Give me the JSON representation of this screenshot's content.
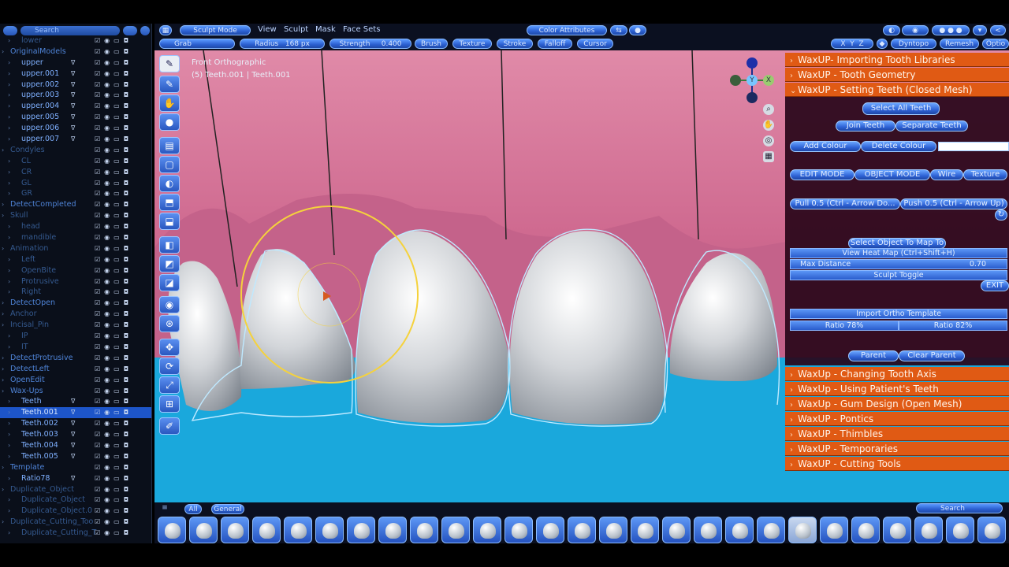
{
  "outliner": {
    "search_placeholder": "Search",
    "rows": [
      {
        "name": "lower",
        "kind": "dim",
        "indent": 1
      },
      {
        "name": "OriginalModels",
        "kind": "coll",
        "indent": 0
      },
      {
        "name": "upper",
        "kind": "obj",
        "indent": 1
      },
      {
        "name": "upper.001",
        "kind": "obj",
        "indent": 1
      },
      {
        "name": "upper.002",
        "kind": "obj",
        "indent": 1
      },
      {
        "name": "upper.003",
        "kind": "obj",
        "indent": 1
      },
      {
        "name": "upper.004",
        "kind": "obj",
        "indent": 1
      },
      {
        "name": "upper.005",
        "kind": "obj",
        "indent": 1
      },
      {
        "name": "upper.006",
        "kind": "obj",
        "indent": 1
      },
      {
        "name": "upper.007",
        "kind": "obj",
        "indent": 1
      },
      {
        "name": "Condyles",
        "kind": "dim",
        "indent": 0
      },
      {
        "name": "CL",
        "kind": "dim",
        "indent": 1
      },
      {
        "name": "CR",
        "kind": "dim",
        "indent": 1
      },
      {
        "name": "GL",
        "kind": "dim",
        "indent": 1
      },
      {
        "name": "GR",
        "kind": "dim",
        "indent": 1
      },
      {
        "name": "DetectCompleted",
        "kind": "coll",
        "indent": 0
      },
      {
        "name": "Skull",
        "kind": "dim",
        "indent": 0
      },
      {
        "name": "head",
        "kind": "dim",
        "indent": 1
      },
      {
        "name": "mandible",
        "kind": "dim",
        "indent": 1
      },
      {
        "name": "Animation",
        "kind": "dim",
        "indent": 0
      },
      {
        "name": "Left",
        "kind": "dim",
        "indent": 1
      },
      {
        "name": "OpenBite",
        "kind": "dim",
        "indent": 1
      },
      {
        "name": "Protrusive",
        "kind": "dim",
        "indent": 1
      },
      {
        "name": "Right",
        "kind": "dim",
        "indent": 1
      },
      {
        "name": "DetectOpen",
        "kind": "coll",
        "indent": 0
      },
      {
        "name": "Anchor",
        "kind": "dim",
        "indent": 0
      },
      {
        "name": "Incisal_Pin",
        "kind": "dim",
        "indent": 0
      },
      {
        "name": "IP",
        "kind": "dim",
        "indent": 1
      },
      {
        "name": "IT",
        "kind": "dim",
        "indent": 1
      },
      {
        "name": "DetectProtrusive",
        "kind": "coll",
        "indent": 0
      },
      {
        "name": "DetectLeft",
        "kind": "coll",
        "indent": 0
      },
      {
        "name": "OpenEdit",
        "kind": "coll",
        "indent": 0
      },
      {
        "name": "Wax-Ups",
        "kind": "coll",
        "indent": 0
      },
      {
        "name": "Teeth",
        "kind": "obj",
        "indent": 1
      },
      {
        "name": "Teeth.001",
        "kind": "sel",
        "indent": 1
      },
      {
        "name": "Teeth.002",
        "kind": "obj",
        "indent": 1
      },
      {
        "name": "Teeth.003",
        "kind": "obj",
        "indent": 1
      },
      {
        "name": "Teeth.004",
        "kind": "obj",
        "indent": 1
      },
      {
        "name": "Teeth.005",
        "kind": "obj",
        "indent": 1
      },
      {
        "name": "Template",
        "kind": "coll",
        "indent": 0
      },
      {
        "name": "Ratio78",
        "kind": "obj",
        "indent": 1
      },
      {
        "name": "Duplicate_Object",
        "kind": "dim",
        "indent": 0
      },
      {
        "name": "Duplicate_Object",
        "kind": "dim",
        "indent": 1
      },
      {
        "name": "Duplicate_Object.0",
        "kind": "dim",
        "indent": 1
      },
      {
        "name": "Duplicate_Cutting_Too",
        "kind": "dim",
        "indent": 0
      },
      {
        "name": "Duplicate_Cutting_T",
        "kind": "dim",
        "indent": 1
      }
    ]
  },
  "header": {
    "mode": "Sculpt Mode",
    "menus": [
      "View",
      "Sculpt",
      "Mask",
      "Face Sets"
    ],
    "color_attributes": "Color Attributes",
    "axes": [
      "X",
      "Y",
      "Z"
    ],
    "dyntopo": "Dyntopo",
    "remesh": "Remesh",
    "options": "Optio"
  },
  "toolheader": {
    "brush": "Grab",
    "radius_label": "Radius",
    "radius_value": "168 px",
    "strength_label": "Strength",
    "strength_value": "0.400",
    "menus": [
      "Brush",
      "Texture",
      "Stroke",
      "Falloff",
      "Cursor"
    ]
  },
  "viewport": {
    "view_name": "Front Orthographic",
    "object_info": "(5) Teeth.001 | Teeth.001",
    "gizmo": {
      "y": "Y",
      "z": "Z",
      "x": "X"
    }
  },
  "panel": {
    "sections_top": [
      {
        "label": "WaxUP-  Importing Tooth Libraries",
        "open": false
      },
      {
        "label": "WaxUP - Tooth Geometry",
        "open": false
      },
      {
        "label": "WaxUP - Setting Teeth (Closed Mesh)",
        "open": true
      }
    ],
    "select_all": "Select All Teeth",
    "join_teeth": "Join Teeth",
    "separate_teeth": "Separate Teeth",
    "add_colour": "Add Colour",
    "delete_colour": "Delete Colour",
    "edit_mode": "EDIT MODE",
    "object_mode": "OBJECT MODE",
    "wire": "Wire",
    "texture": "Texture",
    "pull": "Pull 0.5 (Ctrl - Arrow Do...",
    "push": "Push 0.5 (Ctrl - Arrow Up)",
    "select_map": "Select Object To Map To",
    "heat_map": "View Heat Map (Ctrl+Shift+H)",
    "max_distance_label": "Max Distance",
    "max_distance_value": "0.70",
    "sculpt_toggle": "Sculpt Toggle",
    "exit": "EXIT",
    "import_ortho": "Import Ortho Template",
    "ratio_a": "Ratio 78%",
    "ratio_b": "Ratio 82%",
    "parent": "Parent",
    "clear_parent": "Clear Parent",
    "sections_bottom": [
      "WaxUp - Changing Tooth Axis",
      "WaxUp - Using Patient's Teeth",
      "WaxUp - Gum Design (Open Mesh)",
      "WaxUP - Pontics",
      "WaxUP - Thimbles",
      "WaxUP - Temporaries",
      "WaxUP - Cutting Tools"
    ]
  },
  "bottom": {
    "tabs": [
      "All",
      "General"
    ],
    "search_placeholder": "Search"
  },
  "colors": {
    "accent": "#2b5fd0",
    "panel_header": "#e05a14",
    "viewport_bg": "#1aa8dc",
    "gum": "#c05a82"
  }
}
